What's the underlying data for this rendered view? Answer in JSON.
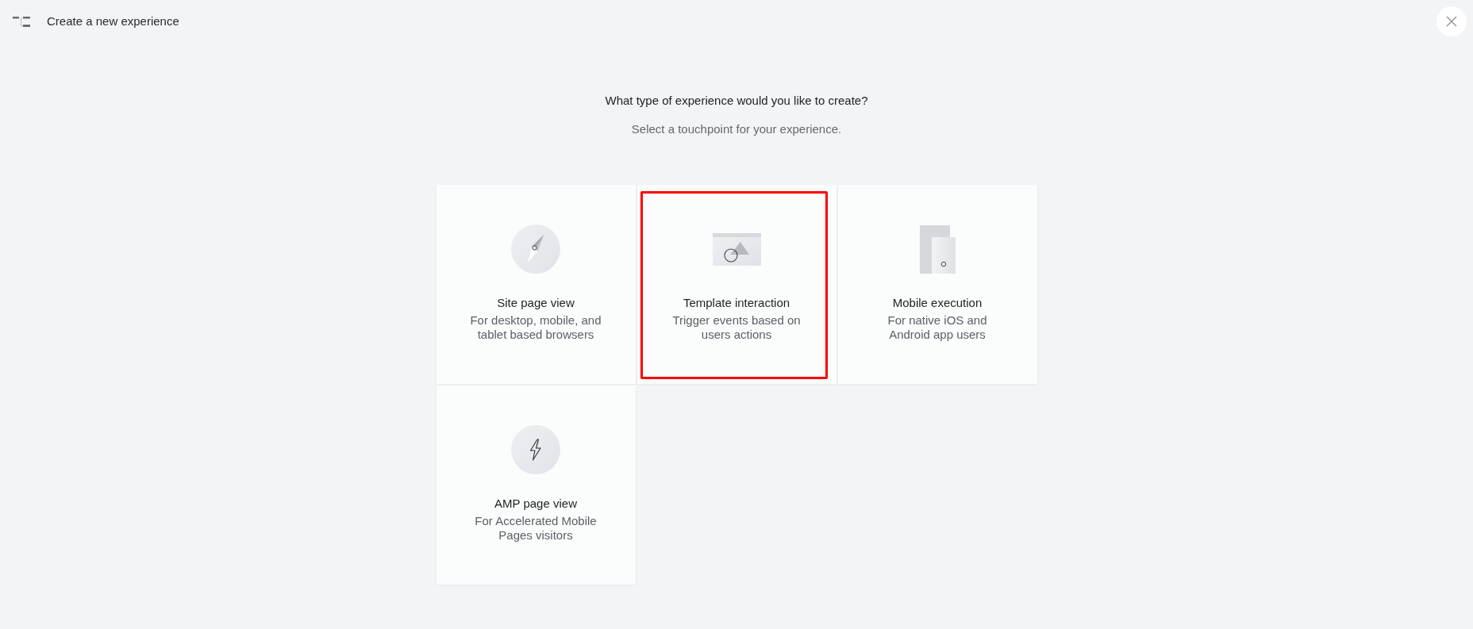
{
  "header": {
    "title": "Create a new experience"
  },
  "prompt": {
    "question": "What type of experience would you like to create?",
    "hint": "Select a touchpoint for your experience."
  },
  "cards": [
    {
      "title": "Site page view",
      "description": "For desktop, mobile, and tablet based browsers",
      "selected": false
    },
    {
      "title": "Template interaction",
      "description": "Trigger events based on users actions",
      "selected": true
    },
    {
      "title": "Mobile execution",
      "description": "For native iOS and Android app users",
      "selected": false
    },
    {
      "title": "AMP page view",
      "description": "For Accelerated Mobile Pages visitors",
      "selected": false
    }
  ]
}
